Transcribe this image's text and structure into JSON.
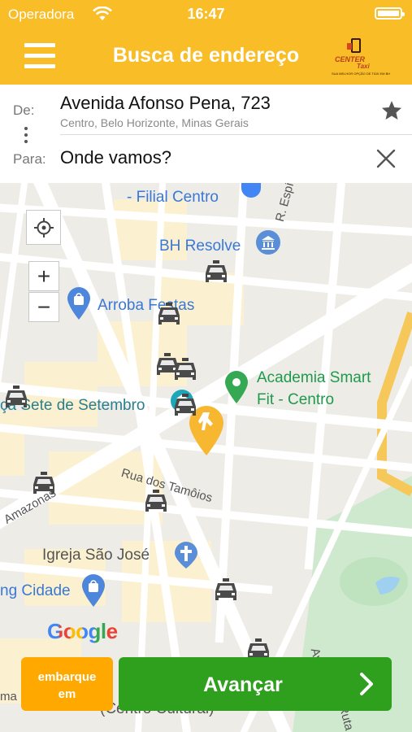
{
  "status_bar": {
    "carrier": "Operadora",
    "time": "16:47"
  },
  "header": {
    "title": "Busca de endereço",
    "logo_name": "Center Taxi",
    "logo_word1": "CENTER",
    "logo_word2": "Taxi",
    "logo_tagline": "SUA MELHOR OPÇÃO DE TÁXI EM BH"
  },
  "route": {
    "from_label": "De:",
    "from_address": "Avenida Afonso Pena, 723",
    "from_detail": "Centro, Belo Horizonte, Minas Gerais",
    "to_label": "Para:",
    "to_placeholder": "Onde vamos?"
  },
  "map": {
    "pois": [
      "- Filial Centro",
      "BH Resolve",
      "Arroba Festas",
      "Academia Smart",
      "Fit - Centro",
      "ça Sete de Setembro",
      "Igreja São José",
      "ng Cidade",
      "(Centro Cultural)"
    ],
    "streets": [
      "R. Espírito Sa",
      "Rua dos Tamôios",
      "Amazonas",
      "ma",
      "Av",
      "Ruta P"
    ],
    "attribution": "Google",
    "zoom_in": "+",
    "zoom_out": "−"
  },
  "actions": {
    "board_label": "embarque em",
    "next_label": "Avançar"
  },
  "colors": {
    "brand_yellow": "#f9bd28",
    "next_green": "#2ea01d",
    "board_orange": "#ffa800"
  }
}
